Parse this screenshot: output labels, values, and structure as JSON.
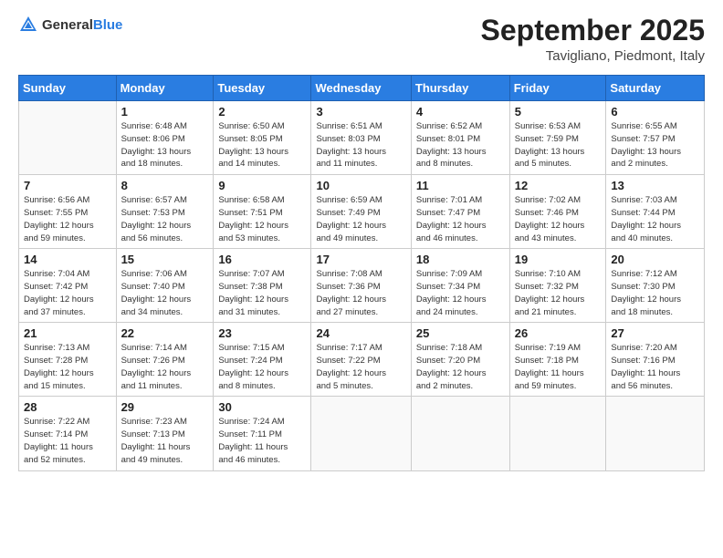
{
  "header": {
    "logo_general": "General",
    "logo_blue": "Blue",
    "title": "September 2025",
    "location": "Tavigliano, Piedmont, Italy"
  },
  "weekdays": [
    "Sunday",
    "Monday",
    "Tuesday",
    "Wednesday",
    "Thursday",
    "Friday",
    "Saturday"
  ],
  "weeks": [
    [
      {
        "day": "",
        "info": ""
      },
      {
        "day": "1",
        "info": "Sunrise: 6:48 AM\nSunset: 8:06 PM\nDaylight: 13 hours\nand 18 minutes."
      },
      {
        "day": "2",
        "info": "Sunrise: 6:50 AM\nSunset: 8:05 PM\nDaylight: 13 hours\nand 14 minutes."
      },
      {
        "day": "3",
        "info": "Sunrise: 6:51 AM\nSunset: 8:03 PM\nDaylight: 13 hours\nand 11 minutes."
      },
      {
        "day": "4",
        "info": "Sunrise: 6:52 AM\nSunset: 8:01 PM\nDaylight: 13 hours\nand 8 minutes."
      },
      {
        "day": "5",
        "info": "Sunrise: 6:53 AM\nSunset: 7:59 PM\nDaylight: 13 hours\nand 5 minutes."
      },
      {
        "day": "6",
        "info": "Sunrise: 6:55 AM\nSunset: 7:57 PM\nDaylight: 13 hours\nand 2 minutes."
      }
    ],
    [
      {
        "day": "7",
        "info": "Sunrise: 6:56 AM\nSunset: 7:55 PM\nDaylight: 12 hours\nand 59 minutes."
      },
      {
        "day": "8",
        "info": "Sunrise: 6:57 AM\nSunset: 7:53 PM\nDaylight: 12 hours\nand 56 minutes."
      },
      {
        "day": "9",
        "info": "Sunrise: 6:58 AM\nSunset: 7:51 PM\nDaylight: 12 hours\nand 53 minutes."
      },
      {
        "day": "10",
        "info": "Sunrise: 6:59 AM\nSunset: 7:49 PM\nDaylight: 12 hours\nand 49 minutes."
      },
      {
        "day": "11",
        "info": "Sunrise: 7:01 AM\nSunset: 7:47 PM\nDaylight: 12 hours\nand 46 minutes."
      },
      {
        "day": "12",
        "info": "Sunrise: 7:02 AM\nSunset: 7:46 PM\nDaylight: 12 hours\nand 43 minutes."
      },
      {
        "day": "13",
        "info": "Sunrise: 7:03 AM\nSunset: 7:44 PM\nDaylight: 12 hours\nand 40 minutes."
      }
    ],
    [
      {
        "day": "14",
        "info": "Sunrise: 7:04 AM\nSunset: 7:42 PM\nDaylight: 12 hours\nand 37 minutes."
      },
      {
        "day": "15",
        "info": "Sunrise: 7:06 AM\nSunset: 7:40 PM\nDaylight: 12 hours\nand 34 minutes."
      },
      {
        "day": "16",
        "info": "Sunrise: 7:07 AM\nSunset: 7:38 PM\nDaylight: 12 hours\nand 31 minutes."
      },
      {
        "day": "17",
        "info": "Sunrise: 7:08 AM\nSunset: 7:36 PM\nDaylight: 12 hours\nand 27 minutes."
      },
      {
        "day": "18",
        "info": "Sunrise: 7:09 AM\nSunset: 7:34 PM\nDaylight: 12 hours\nand 24 minutes."
      },
      {
        "day": "19",
        "info": "Sunrise: 7:10 AM\nSunset: 7:32 PM\nDaylight: 12 hours\nand 21 minutes."
      },
      {
        "day": "20",
        "info": "Sunrise: 7:12 AM\nSunset: 7:30 PM\nDaylight: 12 hours\nand 18 minutes."
      }
    ],
    [
      {
        "day": "21",
        "info": "Sunrise: 7:13 AM\nSunset: 7:28 PM\nDaylight: 12 hours\nand 15 minutes."
      },
      {
        "day": "22",
        "info": "Sunrise: 7:14 AM\nSunset: 7:26 PM\nDaylight: 12 hours\nand 11 minutes."
      },
      {
        "day": "23",
        "info": "Sunrise: 7:15 AM\nSunset: 7:24 PM\nDaylight: 12 hours\nand 8 minutes."
      },
      {
        "day": "24",
        "info": "Sunrise: 7:17 AM\nSunset: 7:22 PM\nDaylight: 12 hours\nand 5 minutes."
      },
      {
        "day": "25",
        "info": "Sunrise: 7:18 AM\nSunset: 7:20 PM\nDaylight: 12 hours\nand 2 minutes."
      },
      {
        "day": "26",
        "info": "Sunrise: 7:19 AM\nSunset: 7:18 PM\nDaylight: 11 hours\nand 59 minutes."
      },
      {
        "day": "27",
        "info": "Sunrise: 7:20 AM\nSunset: 7:16 PM\nDaylight: 11 hours\nand 56 minutes."
      }
    ],
    [
      {
        "day": "28",
        "info": "Sunrise: 7:22 AM\nSunset: 7:14 PM\nDaylight: 11 hours\nand 52 minutes."
      },
      {
        "day": "29",
        "info": "Sunrise: 7:23 AM\nSunset: 7:13 PM\nDaylight: 11 hours\nand 49 minutes."
      },
      {
        "day": "30",
        "info": "Sunrise: 7:24 AM\nSunset: 7:11 PM\nDaylight: 11 hours\nand 46 minutes."
      },
      {
        "day": "",
        "info": ""
      },
      {
        "day": "",
        "info": ""
      },
      {
        "day": "",
        "info": ""
      },
      {
        "day": "",
        "info": ""
      }
    ]
  ]
}
